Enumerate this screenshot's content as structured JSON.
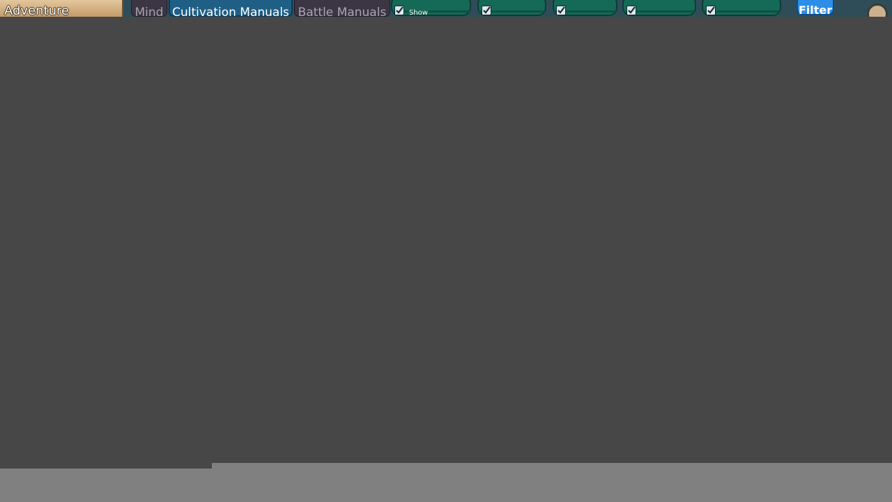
{
  "header": {
    "section_title": "Adventure",
    "tabs": [
      {
        "label": "Mind",
        "active": false
      },
      {
        "label": "Cultivation Manuals",
        "active": true
      },
      {
        "label": "Battle Manuals",
        "active": false
      }
    ],
    "show_checkbox": {
      "label": "Show",
      "checked": true
    },
    "filter_pills": [
      {
        "checked": true
      },
      {
        "checked": true
      },
      {
        "checked": true
      },
      {
        "checked": true
      }
    ],
    "filter_button_label": "Filter"
  },
  "colors": {
    "background": "#474747",
    "section_title_bg": "#d6b585",
    "active_tab_bg": "#1f5f86",
    "inactive_tab_bg": "#3c3543",
    "filter_pill_bg": "#146a57",
    "filter_button_bg": "#2d8ee8",
    "bottom_bar_bg": "#808080"
  },
  "icons": {
    "checkbox": "checkmark-icon",
    "top_right": "round-avatar-icon"
  }
}
